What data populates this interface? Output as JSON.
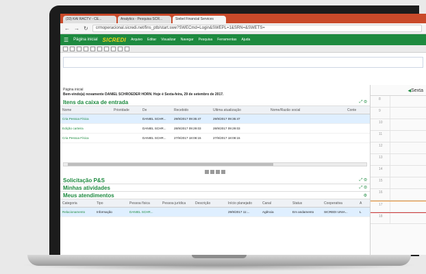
{
  "browser": {
    "tabs": [
      {
        "label": "(33) KAI RACTV - CE... "
      },
      {
        "label": "Analytics - Pesquisa SCR..."
      },
      {
        "label": "Siebel Financial Services"
      }
    ],
    "url": "crmoperacional.sicredi.net/fins_ptb/start.swe?SWECmd=Login&SWEPL=1&SRN=&SWETS="
  },
  "menubar": {
    "home": "Página inicial",
    "logo": "SICREDI",
    "items": [
      "Arquivo",
      "Editar",
      "Visualizar",
      "Navegar",
      "Pesquisa",
      "Ferramentas",
      "Ajuda"
    ]
  },
  "page": {
    "breadcrumb": "Página inicial",
    "welcome": "Bem-vindo(a) novamente DANIEL SCHROEDER HORN.  Hoje é Sexta-feira, 29 de setembro de 2017."
  },
  "inbox": {
    "title": "Itens da caixa de entrada",
    "columns": [
      "Nome",
      "Prioridade",
      "De",
      "Recebido",
      "Última atualização",
      "Nome/Razão social",
      "Conte"
    ],
    "rows": [
      {
        "nome": "Cria Pessoa Física",
        "prioridade": "",
        "de": "DANIEL SCHR...",
        "recebido": "29/9/2017 09:35:47",
        "ultima": "29/9/2017 09:35:47",
        "razao": "",
        "selected": true
      },
      {
        "nome": "Edição carteira",
        "prioridade": "",
        "de": "DANIEL SCHR...",
        "recebido": "28/9/2017 09:29:03",
        "ultima": "28/9/2017 09:29:03",
        "razao": "",
        "selected": false
      },
      {
        "nome": "Cria Pessoa Física",
        "prioridade": "",
        "de": "DANIEL SCHR...",
        "recebido": "27/9/2017 18:08:15",
        "ultima": "27/9/2017 18:08:15",
        "razao": "",
        "selected": false
      }
    ]
  },
  "sections": {
    "solicitacao": "Solicitação P&S",
    "atividades": "Minhas atividades",
    "atendimentos": "Meus atendimentos"
  },
  "atendimentos": {
    "columns": [
      "Categoria",
      "Tipo",
      "Pessoa física",
      "Pessoa jurídica",
      "Descrição",
      "Início planejado",
      "Canal",
      "Status",
      "Cooperativa",
      "A"
    ],
    "rows": [
      {
        "categoria": "Relacionamento",
        "tipo": "Informação",
        "pf": "DANIEL SCHR...",
        "pj": "",
        "desc": "",
        "inicio": "29/9/2017 11:...",
        "canal": "Agência",
        "status": "Em andamento",
        "coop": "SICREDI UNIA...",
        "a": "L"
      }
    ]
  },
  "calendar": {
    "header": "Sexta",
    "hours": [
      "8",
      "9",
      "10",
      "11",
      "12",
      "13",
      "14",
      "15",
      "16",
      "17",
      "18"
    ]
  },
  "icons": {
    "expand": "⤢",
    "settings": "⚙"
  }
}
